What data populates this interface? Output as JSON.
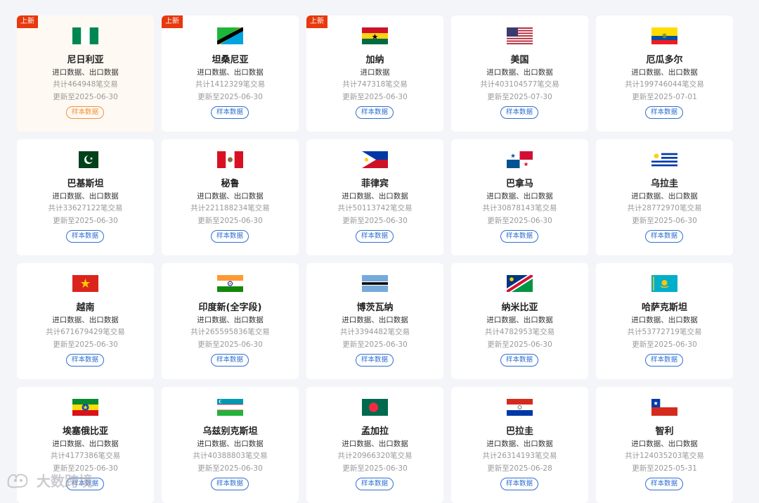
{
  "badge_label": "上新",
  "types_label": "进口数据、出口数据",
  "sample_label": "样本数据",
  "watermark_text": "大数跨境",
  "cards": [
    {
      "name": "尼日利亚",
      "total": "共计464948笔交易",
      "updated": "更新至2025-06-30",
      "is_new": true,
      "flag": "nigeria",
      "hover": true
    },
    {
      "name": "坦桑尼亚",
      "total": "共计1412329笔交易",
      "updated": "更新至2025-06-30",
      "is_new": true,
      "flag": "tanzania"
    },
    {
      "name": "加纳",
      "total": "共计747318笔交易",
      "updated": "更新至2025-06-30",
      "is_new": true,
      "flag": "ghana",
      "types_override": "进口数据"
    },
    {
      "name": "美国",
      "total": "共计403104577笔交易",
      "updated": "更新至2025-07-30",
      "flag": "usa"
    },
    {
      "name": "厄瓜多尔",
      "total": "共计199746044笔交易",
      "updated": "更新至2025-07-01",
      "flag": "ecuador"
    },
    {
      "name": "巴基斯坦",
      "total": "共计33627122笔交易",
      "updated": "更新至2025-06-30",
      "flag": "pakistan"
    },
    {
      "name": "秘鲁",
      "total": "共计221188234笔交易",
      "updated": "更新至2025-06-30",
      "flag": "peru"
    },
    {
      "name": "菲律宾",
      "total": "共计50113742笔交易",
      "updated": "更新至2025-06-30",
      "flag": "philippines"
    },
    {
      "name": "巴拿马",
      "total": "共计30878143笔交易",
      "updated": "更新至2025-06-30",
      "flag": "panama"
    },
    {
      "name": "乌拉圭",
      "total": "共计28772970笔交易",
      "updated": "更新至2025-06-30",
      "flag": "uruguay"
    },
    {
      "name": "越南",
      "total": "共计671679429笔交易",
      "updated": "更新至2025-06-30",
      "flag": "vietnam"
    },
    {
      "name": "印度新(全字段)",
      "total": "共计265595836笔交易",
      "updated": "更新至2025-06-30",
      "flag": "india"
    },
    {
      "name": "博茨瓦纳",
      "total": "共计3394482笔交易",
      "updated": "更新至2025-06-30",
      "flag": "botswana"
    },
    {
      "name": "纳米比亚",
      "total": "共计4782953笔交易",
      "updated": "更新至2025-06-30",
      "flag": "namibia"
    },
    {
      "name": "哈萨克斯坦",
      "total": "共计53772719笔交易",
      "updated": "更新至2025-06-30",
      "flag": "kazakhstan"
    },
    {
      "name": "埃塞俄比亚",
      "total": "共计4177386笔交易",
      "updated": "更新至2025-06-30",
      "flag": "ethiopia"
    },
    {
      "name": "乌兹别克斯坦",
      "total": "共计40388803笔交易",
      "updated": "更新至2025-06-30",
      "flag": "uzbekistan"
    },
    {
      "name": "孟加拉",
      "total": "共计20966320笔交易",
      "updated": "更新至2025-06-30",
      "flag": "bangladesh"
    },
    {
      "name": "巴拉圭",
      "total": "共计26314193笔交易",
      "updated": "更新至2025-06-28",
      "flag": "paraguay"
    },
    {
      "name": "智利",
      "total": "共计124035203笔交易",
      "updated": "更新至2025-05-31",
      "flag": "chile"
    }
  ]
}
